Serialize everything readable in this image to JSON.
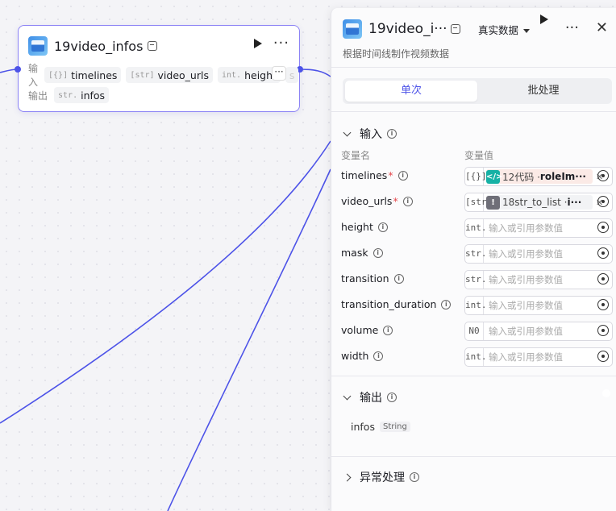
{
  "node": {
    "title": "19video_infos",
    "input_label": "输入",
    "output_label": "输出",
    "inputs": [
      {
        "type": "[{}]",
        "name": "timelines"
      },
      {
        "type": "[str]",
        "name": "video_urls"
      },
      {
        "type": "int.",
        "name": "height"
      }
    ],
    "faded_more": "s",
    "more_label": "···",
    "outputs": [
      {
        "type": "str.",
        "name": "infos"
      }
    ]
  },
  "panel": {
    "title": "19video_i···",
    "data_mode": "真实数据",
    "description": "根据时间线制作视频数据",
    "tabs": {
      "single": "单次",
      "batch": "批处理"
    },
    "input_section": "输入",
    "col_name": "变量名",
    "col_value": "变量值",
    "placeholder": "输入或引用参数值",
    "params": [
      {
        "name": "timelines",
        "required": "*",
        "type": "[{}]",
        "ref_prefix": "12代码 · ",
        "ref_var": "roleIm···"
      },
      {
        "name": "video_urls",
        "required": "*",
        "type": "[str]",
        "ref_prefix": "18str_to_list · ",
        "ref_var": "i···"
      },
      {
        "name": "height",
        "type": "int."
      },
      {
        "name": "mask",
        "type": "str."
      },
      {
        "name": "transition",
        "type": "str."
      },
      {
        "name": "transition_duration",
        "type": "int."
      },
      {
        "name": "volume",
        "type": "N0"
      },
      {
        "name": "width",
        "type": "int."
      }
    ],
    "output_section": "输出",
    "output": {
      "name": "infos",
      "type": "String"
    },
    "error_section": "异常处理"
  },
  "colors": {
    "accent": "#4d53e8",
    "edge": "#4d53e8",
    "required": "#e5484d"
  },
  "icons": {
    "run": "play-icon",
    "more": "more-icon",
    "close": "close-icon",
    "info": "info-icon",
    "target": "target-icon"
  }
}
